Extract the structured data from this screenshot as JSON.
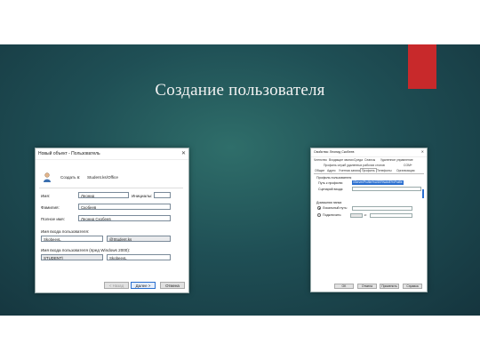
{
  "slide": {
    "title": "Создание пользователя",
    "colors": {
      "background": "#1f4f55",
      "accent": "#c8292b",
      "title": "#f2f2f2"
    }
  },
  "dialog1": {
    "title": "Новый объект - Пользователь",
    "close_glyph": "✕",
    "icon": "user-icon",
    "create_in_label": "Создать в:",
    "create_in_value": "Student.ks/Office",
    "first_name_label": "Имя:",
    "first_name_value": "Леонид",
    "initials_label": "Инициалы:",
    "initials_value": "",
    "last_name_label": "Фамилия:",
    "last_name_value": "Скобеев",
    "full_name_label": "Полное имя:",
    "full_name_value": "Леонид Скобеев",
    "logon_label": "Имя входа пользователя:",
    "logon_value": "SkobeevL",
    "domain_value": "@Student.ks",
    "prewin_label": "Имя входа пользователя (пред Windows 2000):",
    "prewin_domain": "STUDENT\\",
    "prewin_value": "SkobeevL",
    "back_button": "< Назад",
    "next_button": "Далее >",
    "cancel_button": "Отмена"
  },
  "dialog2": {
    "title": "Свойства: Леонид Скобеев",
    "tabs_row1": [
      "Членство",
      "Входящие звонки",
      "Среда",
      "Сеансы",
      "Удаленное управление"
    ],
    "tabs_row2": [
      "Профиль служб удаленных рабочих столов",
      "COM+"
    ],
    "tabs_row3": [
      "Общие",
      "Адрес",
      "Учетная запись",
      "Профиль",
      "Телефоны",
      "Организация"
    ],
    "profile_group": "Профиль пользователя",
    "profile_path_label": "Путь к профилю:",
    "profile_path_value": "\\\\Server\\Profile\\%USERNAME%\\Profile",
    "logon_script_label": "Сценарий входа:",
    "home_group": "Домашняя папка",
    "local_path_label": "Локальный путь:",
    "connect_label": "Подключить:",
    "to_label": "к:",
    "ok_button": "OK",
    "cancel_button": "Отмена",
    "apply_button": "Применить",
    "help_button": "Справка"
  }
}
